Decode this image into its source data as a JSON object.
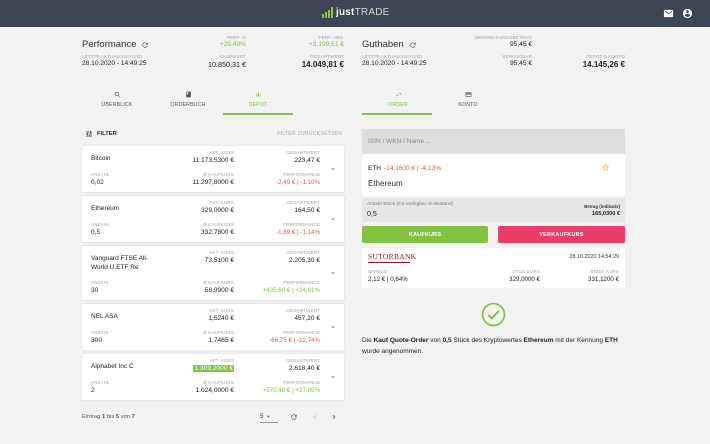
{
  "app": {
    "logo": {
      "bold": "just",
      "normal": "TRADE"
    },
    "colors": {
      "accent": "#82c341",
      "sell": "#ea3c67",
      "topbar": "#3d4452",
      "negative": "#e2574c"
    }
  },
  "topbar": {
    "icons": [
      "mail-icon",
      "account-circle-icon"
    ]
  },
  "performance": {
    "title": "Performance",
    "last_update_label": "LETZTE AKTUALISIERUNG",
    "last_update": "28.10.2020 - 14:49:25",
    "perf_pct_label": "PERF. %",
    "perf_pct": "+29,49%",
    "perf_abs_label": "PERF. ABS.",
    "perf_abs": "+3.199,51 €",
    "kaufwert_label": "KAUFWERT",
    "kaufwert": "10.850,31 €",
    "gesamtwert_label": "GESAMTWERT",
    "gesamtwert": "14.049,81 €"
  },
  "guthaben": {
    "title": "Guthaben",
    "last_update_label": "LETZTE AKTUALISIERUNG",
    "last_update": "28.10.2020 - 14:49:25",
    "ueberweisung_label": "ÜBERWEISUNGSBETRAG",
    "ueberweisung": "95,45 €",
    "verfuegbar_label": "VERFÜGBAR",
    "verfuegbar": "95,45 €",
    "depot_konto_label": "DEPOT & KONTO",
    "depot_konto": "14.145,26 €"
  },
  "left_tabs": [
    {
      "label": "ÜBERBLICK",
      "icon": "search-icon"
    },
    {
      "label": "ORDERBUCH",
      "icon": "book-icon"
    },
    {
      "label": "DEPOT",
      "icon": "bar-chart-icon"
    }
  ],
  "right_tabs": [
    {
      "label": "ORDER",
      "icon": "swap-icon"
    },
    {
      "label": "KONTO",
      "icon": "credit-card-icon"
    }
  ],
  "filter": {
    "label": "FILTER",
    "reset": "FILTER ZURÜCKSETZEN"
  },
  "labels": {
    "akt_kurs": "AKT. KURS",
    "gesamtwert": "GESAMTWERT",
    "anzahl": "ANZAHL",
    "kaufkurs": "Ø KAUFKURS",
    "performance": "PERFORMANCE"
  },
  "positions": [
    {
      "name": "Bitcoin",
      "akt_kurs": "11.173,5300 €",
      "gesamtwert": "223,47 €",
      "anzahl": "0,02",
      "kaufkurs": "11.297,8000 €",
      "performance": "-2,49 € | -1,10%",
      "perf_sign": "neg"
    },
    {
      "name": "Ethereum",
      "akt_kurs": "329,0000 €",
      "gesamtwert": "164,50 €",
      "anzahl": "0,5",
      "kaufkurs": "332,7800 €",
      "performance": "-1,89 € | -1,14%",
      "perf_sign": "neg"
    },
    {
      "name": "Vanguard FTSE All-World U.ETF Re",
      "akt_kurs": "73,5100 €",
      "gesamtwert": "2.205,30 €",
      "anzahl": "30",
      "kaufkurs": "58,9900 €",
      "performance": "+435,60 € | +24,61%",
      "perf_sign": "pos"
    },
    {
      "name": "NEL ASA",
      "akt_kurs": "1,5240 €",
      "gesamtwert": "457,20 €",
      "anzahl": "300",
      "kaufkurs": "1,7465 €",
      "performance": "-66,75 € | -12,74%",
      "perf_sign": "neg"
    },
    {
      "name": "Alphabet Inc C",
      "akt_kurs": "1.309,2000 €",
      "gesamtwert": "2.618,40 €",
      "anzahl": "2",
      "kaufkurs": "1.024,0000 €",
      "performance": "+570,40 € | +27,85%",
      "perf_sign": "pos",
      "highlight": true
    }
  ],
  "pagination": {
    "prefix": "Eintrag ",
    "from": "1",
    "mid1": " bis ",
    "to": "5",
    "mid2": " von ",
    "total": "7",
    "page_size": "5"
  },
  "order": {
    "search_placeholder": "ISIN / WKN / Name ...",
    "asset_symbol": "ETH",
    "asset_change": "-14,1600 € | -4,13%",
    "asset_name": "Ethereum",
    "qty_label": "Anzahl Stück (0,5 verfügbar im Bestand)",
    "qty_value": "0,5",
    "betrag_label": "Betrag (indikativ)",
    "betrag_value": "165,0300 €",
    "buy_label": "KAUFKURS",
    "sell_label": "VERKAUFKURS",
    "bank_logo": "SUTORBANK",
    "quote_time": "28.10.2020  14:54:29",
    "spread_label": "SPREAD",
    "spread_value": "2,12 € | 0,64%",
    "geld_label": "GELD KURS",
    "geld_value": "329,0000 €",
    "brief_label": "BRIEF KURS",
    "brief_value": "331,1200 €"
  },
  "confirmation": {
    "p1": "Die ",
    "b1": "Kauf Quote-Order",
    "p2": " von ",
    "b2": "0,5",
    "p3": " Stück des Kryptowertes ",
    "b3": "Ethereum",
    "p4": " mit der Kennung ",
    "b4": "ETH",
    "p5": " wurde angenommen."
  }
}
